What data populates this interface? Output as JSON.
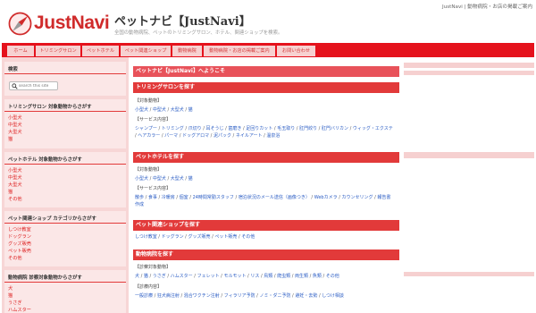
{
  "header": {
    "top_links": "JustNavi | 動物病院・お店の掲載ご案内",
    "logo_text": "JustNavi",
    "site_title": "ペットナビ【JustNavi】",
    "tagline": "全国の動物病院、ペットのトリミングサロン、ホテル、関連ショップを検索。",
    "brand_color": "#e5121c"
  },
  "nav": {
    "tabs": [
      "ホーム",
      "トリミングサロン",
      "ペットホテル",
      "ペット関連ショップ",
      "動物病院",
      "動物病院・お店の掲載ご案内",
      "お問い合わせ"
    ]
  },
  "sidebar": {
    "search": {
      "heading": "検索",
      "placeholder": "search this site"
    },
    "trimming": {
      "heading": "トリミングサロン 対象動物からさがす",
      "items": [
        "小型犬",
        "中型犬",
        "大型犬",
        "猫"
      ]
    },
    "hotel": {
      "heading": "ペットホテル 対象動物からさがす",
      "items": [
        "小型犬",
        "中型犬",
        "大型犬",
        "猫",
        "その他"
      ]
    },
    "shop": {
      "heading": "ペット関連ショップ カテゴリからさがす",
      "items": [
        "しつけ教室",
        "ドッグラン",
        "グッズ販売",
        "ペット販売",
        "その他"
      ]
    },
    "clinic": {
      "heading": "動物病院 診察対象動物からさがす",
      "items": [
        "犬",
        "猫",
        "うさぎ",
        "ハムスター"
      ]
    }
  },
  "main": {
    "welcome": "ペットナビ【JustNavi】へようこそ",
    "trimming": {
      "heading": "トリミングサロンを探す",
      "label1": "【対象動物】",
      "animals": [
        "小型犬",
        "中型犬",
        "大型犬",
        "猫"
      ],
      "label2": "【サービス内容】",
      "services": [
        "シャンプー",
        "トリミング",
        "爪切り",
        "耳そうじ",
        "歯磨き",
        "足回りカット",
        "毛玉取り",
        "肛門絞り",
        "肛門バリカン",
        "ウィッグ・エクステ",
        "ヘアカラー",
        "パーマ",
        "ドッグアロマ",
        "泥パック",
        "ネイルアート",
        "温泉浴"
      ]
    },
    "hotel": {
      "heading": "ペットホテルを探す",
      "label1": "【対象動物】",
      "animals": [
        "小型犬",
        "中型犬",
        "大型犬",
        "猫"
      ],
      "label2": "【サービス内容】",
      "services": [
        "散歩",
        "食事",
        "冷暖房",
        "個室",
        "24時間常勤スタッフ",
        "宿泊状況のメール送信（画像つき）",
        "Webカメラ",
        "カウンセリング",
        "報告書作成"
      ]
    },
    "shop": {
      "heading": "ペット関連ショップを探す",
      "categories": [
        "しつけ教室",
        "ドッグラン",
        "グッズ販売",
        "ペット販売",
        "その他"
      ]
    },
    "clinic": {
      "heading": "動物病院を探す",
      "label1": "【診察対象動物】",
      "animals": [
        "犬",
        "猫",
        "うさぎ",
        "ハムスター",
        "フェレット",
        "モルモット",
        "リス",
        "鳥類",
        "爬虫類",
        "両生類",
        "魚類",
        "その他"
      ],
      "label2": "【診療内容】",
      "services": [
        "一般診療",
        "狂犬病注射",
        "混合ワクチン注射",
        "フィラリア予防",
        "ノミ・ダニ予防",
        "避妊・去勢",
        "しつけ相談"
      ]
    }
  }
}
